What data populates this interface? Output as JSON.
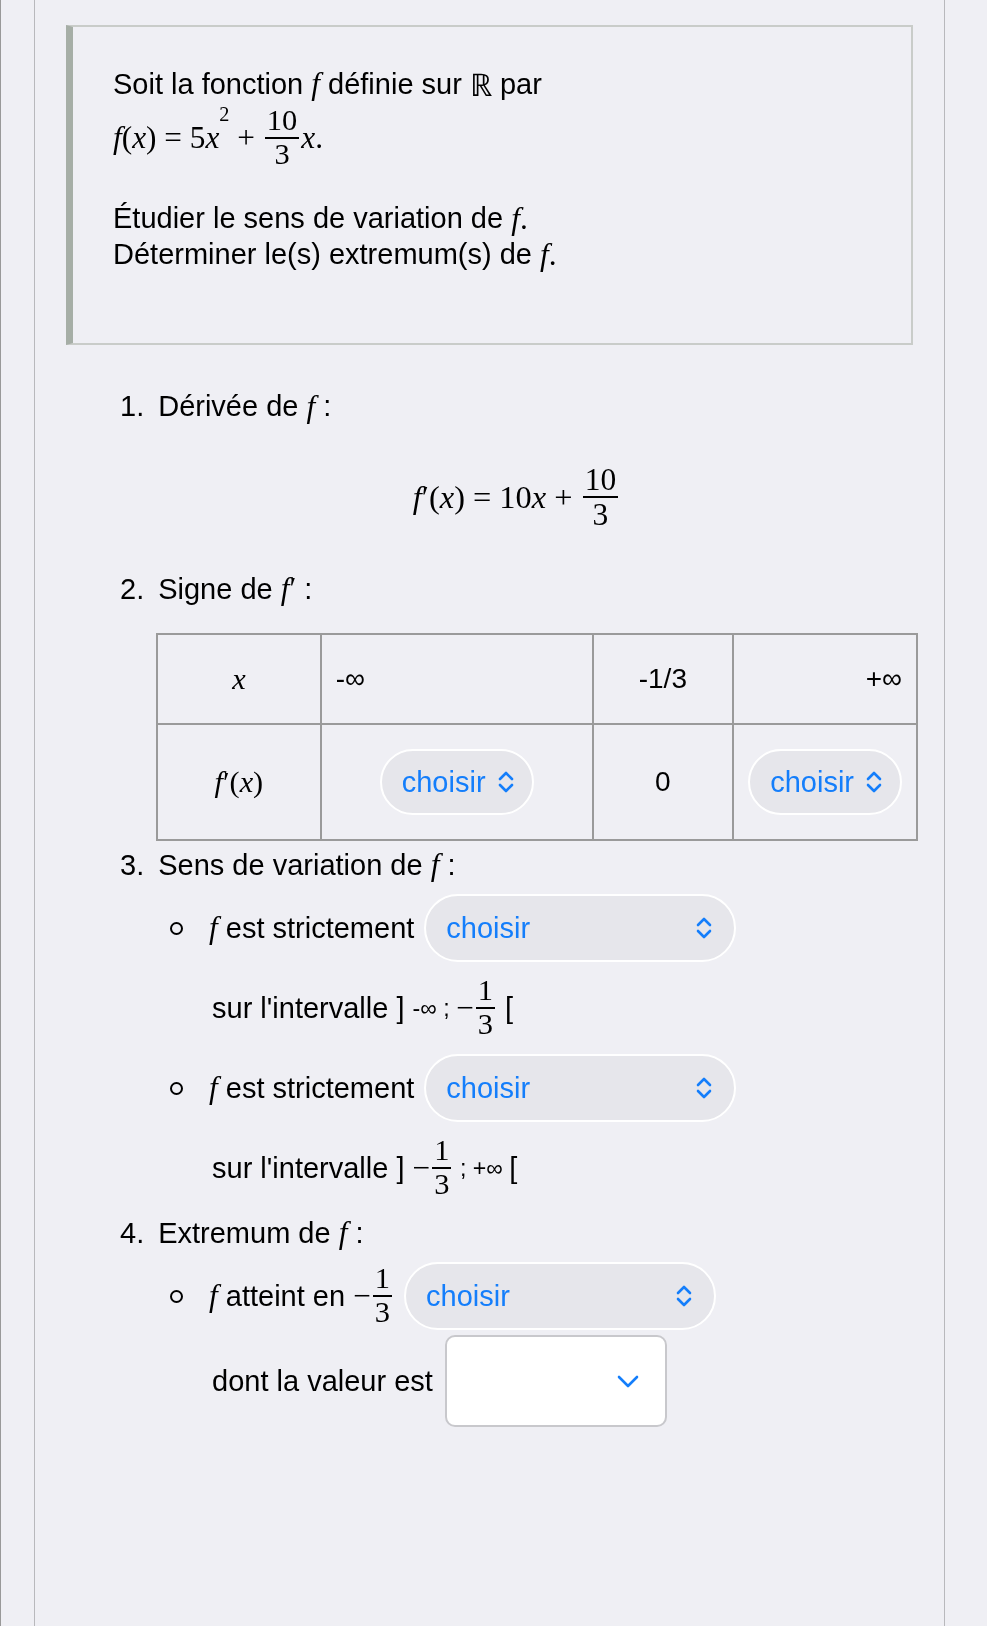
{
  "statement": {
    "lines": [
      [
        {
          "kind": "text",
          "text": "Soit la fonction "
        },
        {
          "kind": "var",
          "text": "f"
        },
        {
          "kind": "text",
          "text": " définie sur "
        },
        {
          "kind": "math",
          "text": "ℝ"
        },
        {
          "kind": "text",
          "text": " par"
        }
      ],
      [
        {
          "kind": "var",
          "text": "f"
        },
        {
          "kind": "math",
          "text": "("
        },
        {
          "kind": "var",
          "text": "x"
        },
        {
          "kind": "math",
          "text": ") = 5"
        },
        {
          "kind": "var",
          "text": "x"
        },
        {
          "kind": "sup",
          "text": "2"
        },
        {
          "kind": "math",
          "text": " + "
        },
        {
          "kind": "frac",
          "num": "10",
          "den": "3"
        },
        {
          "kind": "var",
          "text": "x"
        },
        {
          "kind": "math",
          "text": "."
        }
      ]
    ],
    "tasks": [
      [
        {
          "kind": "text",
          "text": "Étudier le sens de variation de "
        },
        {
          "kind": "var",
          "text": "f"
        },
        {
          "kind": "math",
          "text": "."
        }
      ],
      [
        {
          "kind": "text",
          "text": "Déterminer le(s) extremum(s) de "
        },
        {
          "kind": "var",
          "text": "f"
        },
        {
          "kind": "math",
          "text": "."
        }
      ]
    ]
  },
  "steps": [
    {
      "number": "1.",
      "kind": "formula",
      "title": [
        {
          "kind": "text",
          "text": "Dérivée de "
        },
        {
          "kind": "var",
          "text": "f"
        },
        {
          "kind": "text",
          "text": " :"
        }
      ],
      "formula": [
        {
          "kind": "var",
          "text": "f"
        },
        {
          "kind": "math",
          "text": "′("
        },
        {
          "kind": "var",
          "text": "x"
        },
        {
          "kind": "math",
          "text": ") = 10"
        },
        {
          "kind": "var",
          "text": "x"
        },
        {
          "kind": "math",
          "text": " + "
        },
        {
          "kind": "frac",
          "num": "10",
          "den": "3"
        }
      ]
    },
    {
      "number": "2.",
      "kind": "table",
      "title": [
        {
          "kind": "text",
          "text": "Signe de "
        },
        {
          "kind": "var",
          "text": "f"
        },
        {
          "kind": "math",
          "text": "′"
        },
        {
          "kind": "text",
          "text": " :"
        }
      ],
      "table": {
        "rows": [
          [
            [
              {
                "kind": "var",
                "text": "x"
              }
            ],
            [
              {
                "kind": "text",
                "text": "-∞"
              }
            ],
            [
              {
                "kind": "text",
                "text": "-1/3"
              }
            ],
            [
              {
                "kind": "text",
                "text": "+∞"
              }
            ]
          ],
          [
            [
              {
                "kind": "var",
                "text": "f"
              },
              {
                "kind": "math",
                "text": "′("
              },
              {
                "kind": "var",
                "text": "x"
              },
              {
                "kind": "math",
                "text": ")"
              }
            ],
            [
              {
                "kind": "select",
                "value": "choisir"
              }
            ],
            [
              {
                "kind": "text",
                "text": "0"
              }
            ],
            [
              {
                "kind": "select",
                "value": "choisir"
              }
            ]
          ]
        ]
      }
    },
    {
      "number": "3.",
      "kind": "bullets",
      "title": [
        {
          "kind": "text",
          "text": "Sens de variation de "
        },
        {
          "kind": "var",
          "text": "f"
        },
        {
          "kind": "text",
          "text": " :"
        }
      ],
      "bullets": [
        {
          "lines": [
            [
              {
                "kind": "var",
                "text": "f"
              },
              {
                "kind": "text",
                "text": " est strictement"
              },
              {
                "kind": "select",
                "value": "choisir"
              }
            ],
            [
              {
                "kind": "text",
                "text": "sur l'intervalle ] "
              },
              {
                "kind": "small",
                "text": "-∞ ; "
              },
              {
                "kind": "math",
                "text": "−"
              },
              {
                "kind": "frac",
                "num": "1",
                "den": "3"
              },
              {
                "kind": "text",
                "text": " ["
              }
            ]
          ]
        },
        {
          "lines": [
            [
              {
                "kind": "var",
                "text": "f"
              },
              {
                "kind": "text",
                "text": " est strictement"
              },
              {
                "kind": "select",
                "value": "choisir"
              }
            ],
            [
              {
                "kind": "text",
                "text": "sur l'intervalle ] "
              },
              {
                "kind": "math",
                "text": "−"
              },
              {
                "kind": "frac",
                "num": "1",
                "den": "3"
              },
              {
                "kind": "small",
                "text": " ; +∞ "
              },
              {
                "kind": "text",
                "text": "["
              }
            ]
          ]
        }
      ]
    },
    {
      "number": "4.",
      "kind": "bullets",
      "title": [
        {
          "kind": "text",
          "text": "Extremum de "
        },
        {
          "kind": "var",
          "text": "f"
        },
        {
          "kind": "text",
          "text": " :"
        }
      ],
      "bullets": [
        {
          "lines": [
            [
              {
                "kind": "var",
                "text": "f"
              },
              {
                "kind": "text",
                "text": " atteint en "
              },
              {
                "kind": "math",
                "text": "−"
              },
              {
                "kind": "frac",
                "num": "1",
                "den": "3"
              },
              {
                "kind": "select",
                "value": "choisir"
              }
            ],
            [
              {
                "kind": "text",
                "text": "dont la valeur est"
              },
              {
                "kind": "field"
              }
            ]
          ]
        }
      ]
    }
  ]
}
